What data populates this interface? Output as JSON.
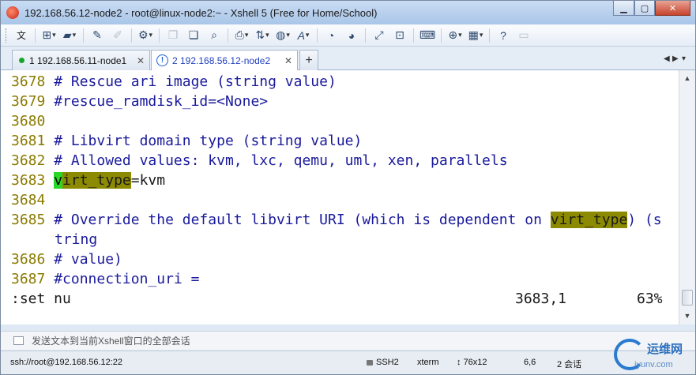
{
  "window": {
    "title": "192.168.56.12-node2 - root@linux-node2:~ - Xshell 5 (Free for Home/School)"
  },
  "toolbar": {
    "lang_label": "文",
    "items": [
      "new-session-icon",
      "open-folder-icon",
      "brush-icon",
      "eraser-icon",
      "properties-icon",
      "copy-icon",
      "paste-icon",
      "find-icon",
      "print-icon",
      "transfer-icon",
      "globe-icon",
      "font-icon",
      "xftp-icon",
      "xmanager-icon",
      "fullscreen-icon",
      "lock-icon",
      "keyboard-icon",
      "add-pane-icon",
      "layout-icon",
      "help-icon",
      "chat-icon"
    ]
  },
  "tabs": [
    {
      "label": "1 192.168.56.11-node1",
      "active": false
    },
    {
      "label": "2 192.168.56.12-node2",
      "active": true
    }
  ],
  "terminal": {
    "lines": [
      {
        "num": "3678",
        "text": "# Rescue ari image (string value)"
      },
      {
        "num": "3679",
        "text": "#rescue_ramdisk_id=<None>"
      },
      {
        "num": "3680",
        "text": ""
      },
      {
        "num": "3681",
        "text": "# Libvirt domain type (string value)"
      },
      {
        "num": "3682",
        "text": "# Allowed values: kvm, lxc, qemu, uml, xen, parallels"
      },
      {
        "num": "3683",
        "cursor_char": "v",
        "highlight": "irt_type",
        "rest": "=kvm"
      },
      {
        "num": "3684",
        "text": ""
      },
      {
        "num": "3685",
        "pre": "# Override the default libvirt URI (which is dependent on ",
        "highlight": "virt_type",
        "post": ") (s"
      },
      {
        "num": "",
        "text": "tring"
      },
      {
        "num": "3686",
        "text": "# value)"
      },
      {
        "num": "3687",
        "text": "#connection_uri ="
      }
    ],
    "command": ":set nu",
    "position": "3683,1",
    "percent": "63%"
  },
  "compose": {
    "placeholder": "发送文本到当前Xshell窗口的全部会话"
  },
  "statusbar": {
    "connection": "ssh://root@192.168.56.12:22",
    "protocol": "SSH2",
    "terminal_type": "xterm",
    "size": "76x12",
    "cursor": "6,6",
    "sessions": "2 会话"
  },
  "watermark": {
    "name": "运维网",
    "url": "iyunv.com"
  }
}
